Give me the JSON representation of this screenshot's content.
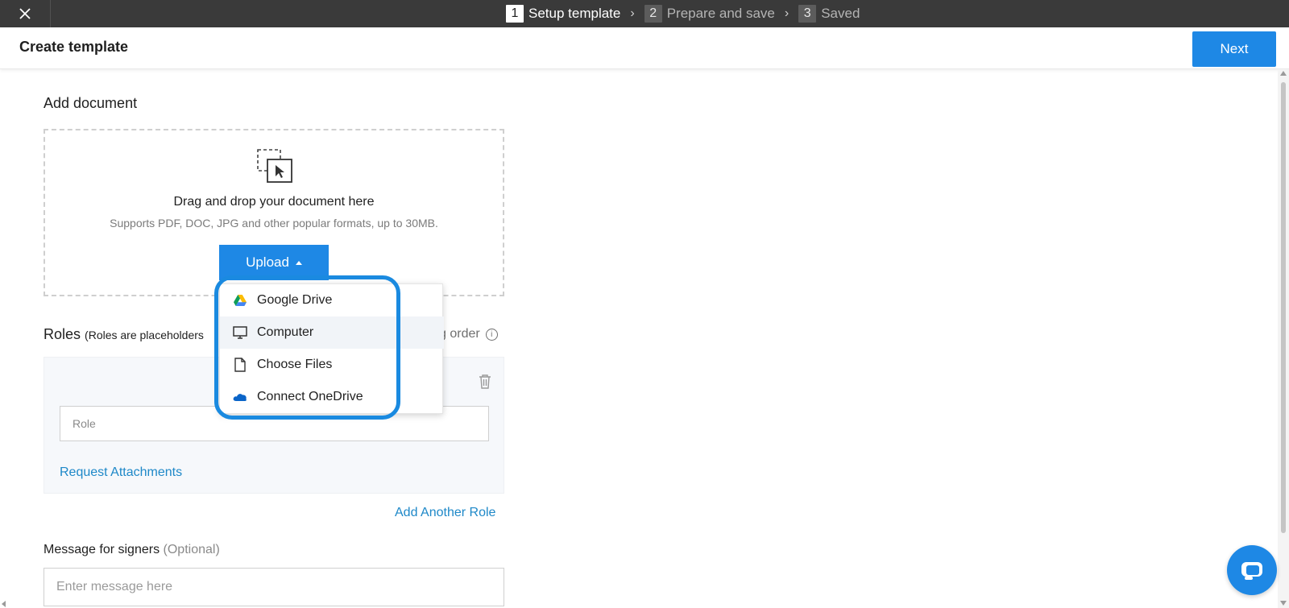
{
  "topbar": {
    "steps": [
      {
        "num": "1",
        "label": "Setup template"
      },
      {
        "num": "2",
        "label": "Prepare and save"
      },
      {
        "num": "3",
        "label": "Saved"
      }
    ]
  },
  "header": {
    "title": "Create template",
    "next_label": "Next"
  },
  "add_document": {
    "label": "Add document",
    "drop_title": "Drag and drop your document here",
    "drop_subtitle": "Supports PDF, DOC, JPG and other popular formats, up to 30MB.",
    "upload_label": "Upload"
  },
  "upload_menu": {
    "items": [
      {
        "label": "Google Drive",
        "icon": "google-drive-icon"
      },
      {
        "label": "Computer",
        "icon": "computer-icon"
      },
      {
        "label": "Choose Files",
        "icon": "file-icon"
      },
      {
        "label": "Connect OneDrive",
        "icon": "onedrive-icon"
      }
    ]
  },
  "roles": {
    "label": "Roles",
    "hint": "(Roles are placeholders",
    "signing_order_partial": "g order",
    "role_placeholder": "Role",
    "request_attachments": "Request Attachments",
    "add_another_role": "Add Another Role"
  },
  "message": {
    "label": "Message for signers",
    "optional": "(Optional)",
    "placeholder": "Enter message here"
  },
  "colors": {
    "accent": "#1e88e5",
    "link": "#1e88c8",
    "topbar": "#3a3a3a",
    "highlight": "#1a8ae0"
  }
}
